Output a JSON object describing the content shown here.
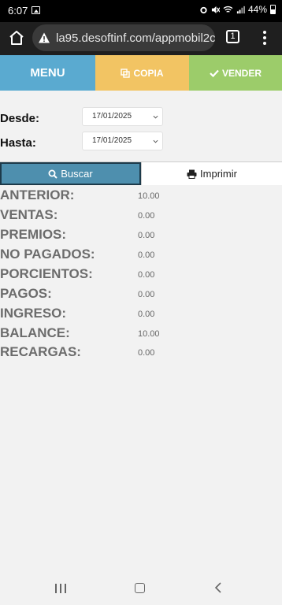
{
  "status_bar": {
    "time": "6:07",
    "battery": "44%"
  },
  "browser": {
    "url": "la95.desoftinf.com/appmobil2c",
    "tab_count": "1"
  },
  "nav": {
    "menu": "MENU",
    "copia": "COPIA",
    "vender": "VENDER"
  },
  "filters": {
    "desde_label": "Desde:",
    "desde_value": "17/01/2025",
    "hasta_label": "Hasta:",
    "hasta_value": "17/01/2025"
  },
  "actions": {
    "buscar": "Buscar",
    "imprimir": "Imprimir"
  },
  "summary": [
    {
      "label": "ANTERIOR:",
      "value": "10.00"
    },
    {
      "label": "VENTAS:",
      "value": "0.00"
    },
    {
      "label": "PREMIOS:",
      "value": "0.00"
    },
    {
      "label": "NO PAGADOS:",
      "value": "0.00"
    },
    {
      "label": "PORCIENTOS:",
      "value": "0.00"
    },
    {
      "label": "PAGOS:",
      "value": "0.00"
    },
    {
      "label": "INGRESO:",
      "value": "0.00"
    },
    {
      "label": "BALANCE:",
      "value": "10.00"
    },
    {
      "label": "RECARGAS:",
      "value": "0.00"
    }
  ],
  "colors": {
    "menu_bg": "#5aaad0",
    "copia_bg": "#f2c463",
    "vender_bg": "#9ccc6a",
    "buscar_bg": "#4e8fae",
    "summary_text": "#6c6c6c"
  }
}
